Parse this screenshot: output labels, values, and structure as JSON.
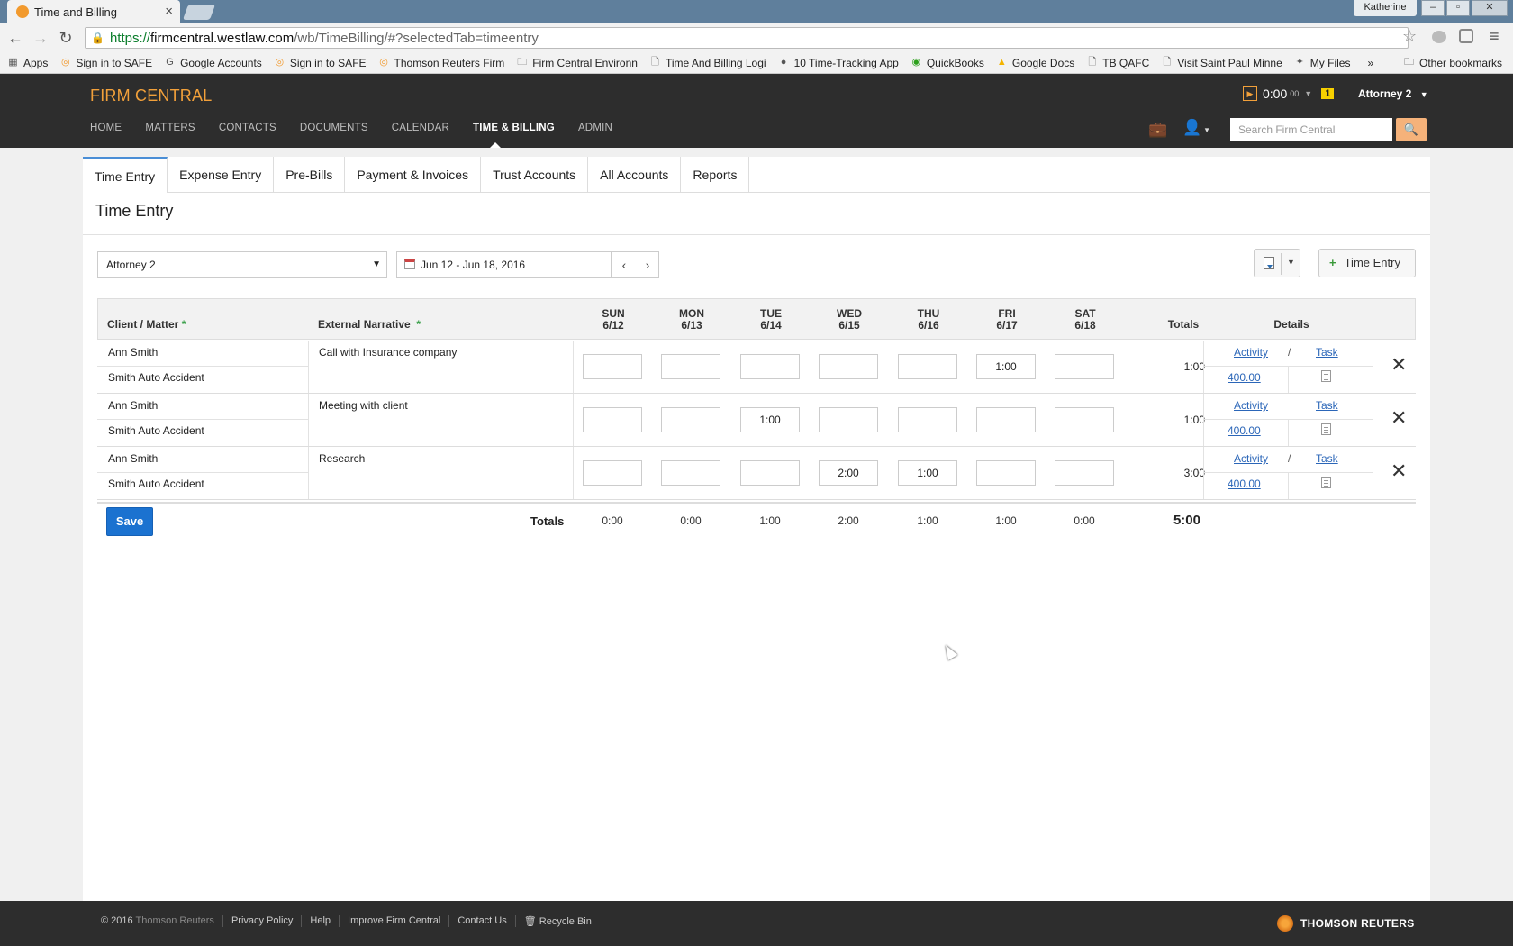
{
  "browser": {
    "tab_title": "Time and Billing",
    "profile_name": "Katherine",
    "url_scheme": "https://",
    "url_domain": "firmcentral.westlaw.com",
    "url_path": "/wb/TimeBilling/#?selectedTab=timeentry",
    "bookmarks": [
      {
        "label": "Apps",
        "icon": "apps-grid-icon"
      },
      {
        "label": "Sign in to SAFE",
        "icon": "safe-icon"
      },
      {
        "label": "Google Accounts",
        "icon": "google-icon"
      },
      {
        "label": "Sign in to SAFE",
        "icon": "safe-icon"
      },
      {
        "label": "Thomson Reuters Firm",
        "icon": "tr-icon"
      },
      {
        "label": "Firm Central Environn",
        "icon": "folder-icon"
      },
      {
        "label": "Time And Billing Logi",
        "icon": "page-icon"
      },
      {
        "label": "10 Time-Tracking App",
        "icon": "fc-icon"
      },
      {
        "label": "QuickBooks",
        "icon": "quickbooks-icon"
      },
      {
        "label": "Google Docs",
        "icon": "drive-icon"
      },
      {
        "label": "TB QAFC",
        "icon": "page-icon"
      },
      {
        "label": "Visit Saint Paul Minne",
        "icon": "page-icon"
      },
      {
        "label": "My Files",
        "icon": "myfiles-icon"
      }
    ],
    "more_bookmarks": "»",
    "other_bookmarks": "Other bookmarks"
  },
  "app": {
    "logo": "FIRM CENTRAL",
    "timer": {
      "value": "0:00",
      "sub": "00",
      "badge": "1"
    },
    "user_menu": "Attorney 2",
    "nav": [
      {
        "label": "HOME",
        "active": false
      },
      {
        "label": "MATTERS",
        "active": false
      },
      {
        "label": "CONTACTS",
        "active": false
      },
      {
        "label": "DOCUMENTS",
        "active": false
      },
      {
        "label": "CALENDAR",
        "active": false
      },
      {
        "label": "TIME & BILLING",
        "active": true
      },
      {
        "label": "ADMIN",
        "active": false
      }
    ],
    "search_placeholder": "Search Firm Central"
  },
  "subtabs": [
    {
      "label": "Time Entry",
      "active": true
    },
    {
      "label": "Expense Entry",
      "active": false
    },
    {
      "label": "Pre-Bills",
      "active": false
    },
    {
      "label": "Payment & Invoices",
      "active": false
    },
    {
      "label": "Trust Accounts",
      "active": false
    },
    {
      "label": "All Accounts",
      "active": false
    },
    {
      "label": "Reports",
      "active": false
    }
  ],
  "page_title": "Time Entry",
  "controls": {
    "timekeeper": "Attorney 2",
    "date_range": "Jun 12 - Jun 18, 2016",
    "add_button": "Time Entry"
  },
  "table": {
    "headers": {
      "client_matter": "Client / Matter",
      "narrative": "External Narrative",
      "totals": "Totals",
      "details": "Details"
    },
    "required_mark": "*",
    "days": [
      {
        "dow": "SUN",
        "date": "6/12"
      },
      {
        "dow": "MON",
        "date": "6/13"
      },
      {
        "dow": "TUE",
        "date": "6/14"
      },
      {
        "dow": "WED",
        "date": "6/15"
      },
      {
        "dow": "THU",
        "date": "6/16"
      },
      {
        "dow": "FRI",
        "date": "6/17"
      },
      {
        "dow": "SAT",
        "date": "6/18"
      }
    ],
    "rows": [
      {
        "client": "Ann Smith",
        "matter": "Smith Auto Accident",
        "narrative": "Call with Insurance company",
        "hours": [
          "",
          "",
          "",
          "",
          "",
          "1:00",
          ""
        ],
        "total": "1:00",
        "activity": "Activity",
        "slash": "/",
        "task": "Task",
        "rate": "400.00"
      },
      {
        "client": "Ann Smith",
        "matter": "Smith Auto Accident",
        "narrative": "Meeting with client",
        "hours": [
          "",
          "",
          "1:00",
          "",
          "",
          "",
          ""
        ],
        "total": "1:00",
        "activity": "Activity",
        "slash": "",
        "task": "Task",
        "rate": "400.00"
      },
      {
        "client": "Ann Smith",
        "matter": "Smith Auto Accident",
        "narrative": "Research",
        "hours": [
          "",
          "",
          "",
          "2:00",
          "1:00",
          "",
          ""
        ],
        "total": "3:00",
        "activity": "Activity",
        "slash": "/",
        "task": "Task",
        "rate": "400.00"
      }
    ],
    "save_label": "Save",
    "totals_label": "Totals",
    "day_totals": [
      "0:00",
      "0:00",
      "1:00",
      "2:00",
      "1:00",
      "1:00",
      "0:00"
    ],
    "grand_total": "5:00"
  },
  "footer": {
    "copyright_year": "© 2016",
    "copyright_owner": "Thomson Reuters",
    "links": [
      "Privacy Policy",
      "Help",
      "Improve Firm Central",
      "Contact Us",
      "Recycle Bin"
    ],
    "brand": "THOMSON REUTERS"
  }
}
